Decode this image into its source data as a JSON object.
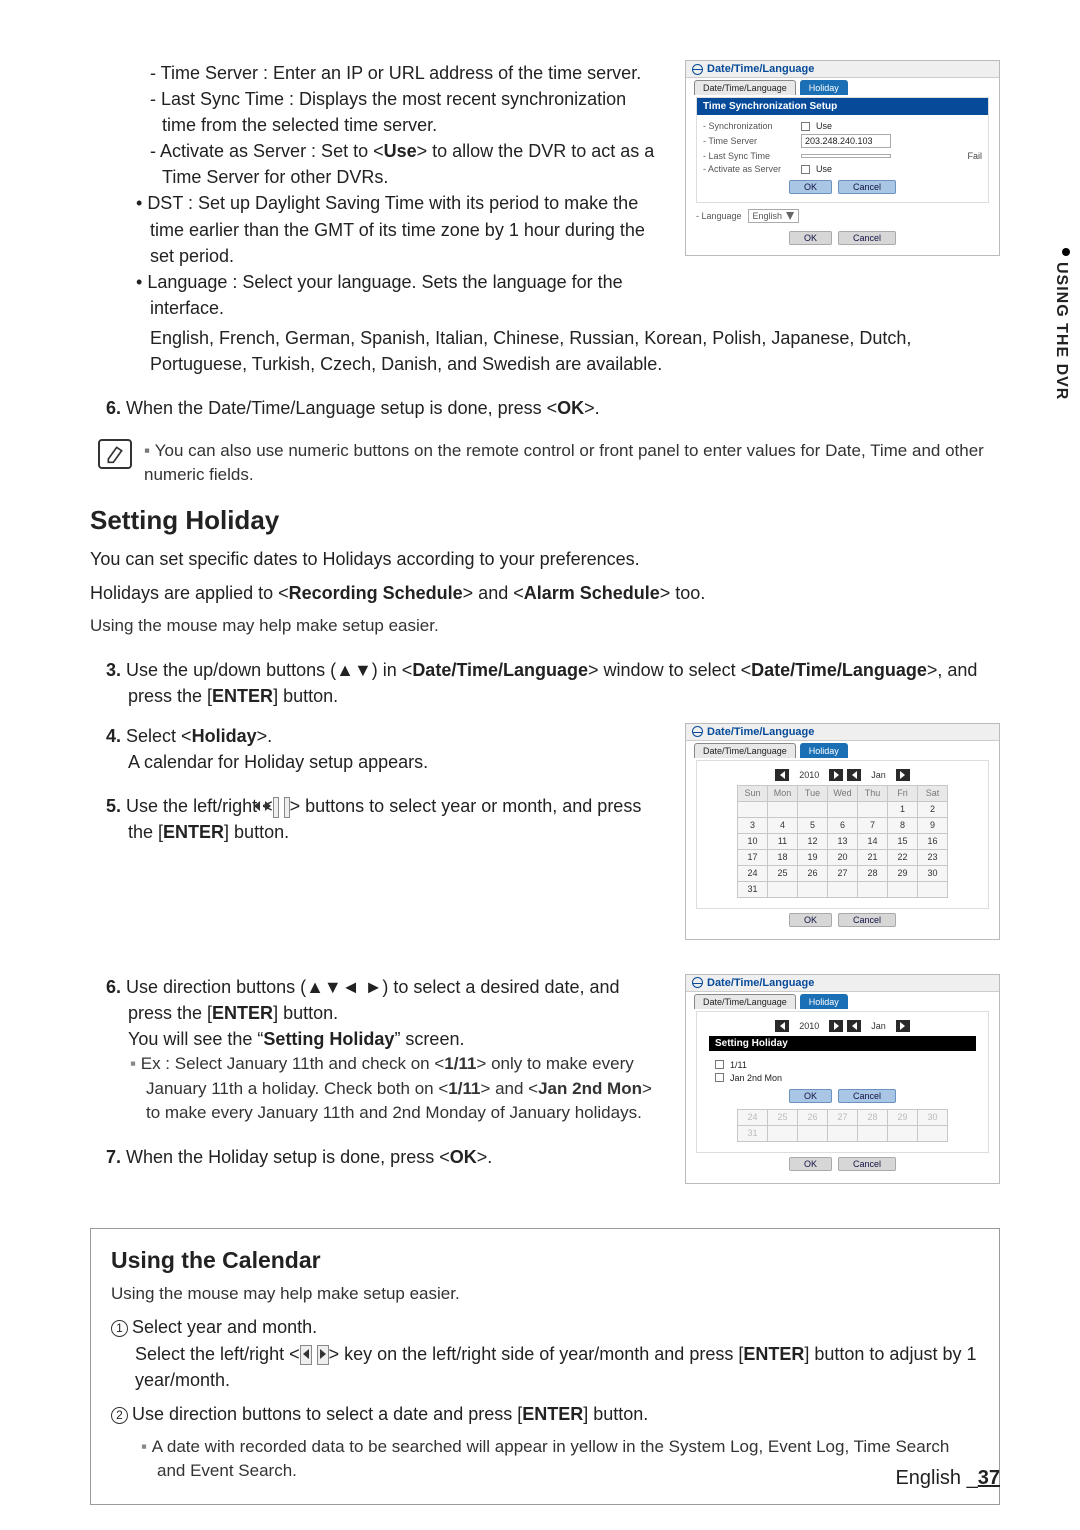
{
  "sidetab": {
    "label": "USING THE DVR"
  },
  "top": {
    "dash1": "- Time Server : Enter an IP or URL address of the time server.",
    "dash2": "- Last Sync Time : Displays the most recent synchronization time from the selected time server.",
    "dash3a": "- Activate as Server : Set to <",
    "dash3b": "Use",
    "dash3c": "> to allow the DVR to act as a Time Server for other DVRs.",
    "b1": "DST : Set up Daylight Saving Time with its period to make the time earlier than the GMT of its time zone by 1 hour during the set period.",
    "b2": "Language : Select your language. Sets the language for the interface.",
    "after": "English, French, German, Spanish, Italian, Chinese, Russian, Korean, Polish, Japanese, Dutch, Portuguese, Turkish, Czech, Danish, and Swedish are available."
  },
  "fig1": {
    "title": "Date/Time/Language",
    "tab1": "Date/Time/Language",
    "tab2": "Holiday",
    "bar": "Time Synchronization Setup",
    "r1l": "- Synchronization",
    "r1v": "Use",
    "r2l": "- Time Server",
    "r2v": "203.248.240.103",
    "r3l": "- Last Sync Time",
    "r3v": "Fail",
    "r4l": "- Activate as Server",
    "r4v": "Use",
    "ok": "OK",
    "cancel": "Cancel",
    "langlabel": "- Language",
    "langval": "English"
  },
  "step6a": "6.",
  "step6b": "When the Date/Time/Language setup is done, press <",
  "step6c": "OK",
  "step6d": ">.",
  "note1": "You can also use numeric buttons on the remote control or front panel to enter values for Date, Time and other numeric fields.",
  "section_holiday": {
    "title": "Setting Holiday",
    "p1a": "You can set specific dates to Holidays according to your preferences.",
    "p1b_a": "Holidays are applied to <",
    "p1b_b": "Recording Schedule",
    "p1b_c": "> and <",
    "p1b_d": "Alarm Schedule",
    "p1b_e": "> too.",
    "p2": "Using the mouse may help make setup easier.",
    "s3a": "3.",
    "s3b": "Use the up/down buttons (▲▼) in <",
    "s3c": "Date/Time/Language",
    "s3d": "> window to select <",
    "s3e": "Date/Time/Language",
    "s3f": ">, and press the [",
    "s3g": "ENTER",
    "s3h": "] button.",
    "s4a": "4.",
    "s4b": "Select <",
    "s4c": "Holiday",
    "s4d": ">.",
    "s4e": "A calendar for Holiday setup appears.",
    "s5a": "5.",
    "s5b": "Use the left/right <",
    "s5c": "> buttons to select year or month, and press the [",
    "s5d": "ENTER",
    "s5e": "] button."
  },
  "fig2": {
    "title": "Date/Time/Language",
    "tab1": "Date/Time/Language",
    "tab2": "Holiday",
    "year": "2010",
    "month": "Jan",
    "dow": [
      "Sun",
      "Mon",
      "Tue",
      "Wed",
      "Thu",
      "Fri",
      "Sat"
    ],
    "ok": "OK",
    "cancel": "Cancel"
  },
  "chart_data": {
    "type": "table",
    "title": "Holiday calendar — January 2010",
    "columns": [
      "Sun",
      "Mon",
      "Tue",
      "Wed",
      "Thu",
      "Fri",
      "Sat"
    ],
    "rows": [
      [
        "",
        "",
        "",
        "",
        "",
        "1",
        "2"
      ],
      [
        "3",
        "4",
        "5",
        "6",
        "7",
        "8",
        "9"
      ],
      [
        "10",
        "11",
        "12",
        "13",
        "14",
        "15",
        "16"
      ],
      [
        "17",
        "18",
        "19",
        "20",
        "21",
        "22",
        "23"
      ],
      [
        "24",
        "25",
        "26",
        "27",
        "28",
        "29",
        "30"
      ],
      [
        "31",
        "",
        "",
        "",
        "",
        "",
        ""
      ]
    ]
  },
  "row3": {
    "s6a": "6.",
    "s6b": "Use direction buttons (▲▼◄ ►) to select a desired date, and press the [",
    "s6c": "ENTER",
    "s6d": "] button.",
    "s6e_a": "You will see the “",
    "s6e_b": "Setting Holiday",
    "s6e_c": "” screen.",
    "sub_a": "Ex : Select January 11th and check on <",
    "sub_b": "1/11",
    "sub_c": "> only to make every January 11th a holiday. Check both on <",
    "sub_d": "1/11",
    "sub_e": "> and <",
    "sub_f": "Jan 2nd Mon",
    "sub_g": "> to make every January 11th and 2nd Monday of January holidays.",
    "s7a": "7.",
    "s7b": "When the Holiday setup is done, press <",
    "s7c": "OK",
    "s7d": ">."
  },
  "fig3": {
    "title": "Date/Time/Language",
    "tab1": "Date/Time/Language",
    "tab2": "Holiday",
    "year": "2010",
    "month": "Jan",
    "barlabel": "Setting Holiday",
    "opt1": "1/11",
    "opt2": "Jan 2nd Mon",
    "ok": "OK",
    "cancel": "Cancel",
    "row_vals": [
      "24",
      "25",
      "26",
      "27",
      "28",
      "29",
      "30"
    ],
    "row2_vals": [
      "31",
      "",
      "",
      "",
      "",
      "",
      ""
    ]
  },
  "callout": {
    "title": "Using the Calendar",
    "p1": "Using the mouse may help make setup easier.",
    "l1": "Select year and month.",
    "l1b_a": "Select the left/right <",
    "l1b_b": "> key on the left/right side of year/month and press [",
    "l1b_c": "ENTER",
    "l1b_d": "] button to adjust by 1 year/month.",
    "l2_a": "Use direction buttons to select a date and press [",
    "l2_b": "ENTER",
    "l2_c": "] button.",
    "sub": "A date with recorded data to be searched will appear in yellow in the System Log, Event Log, Time Search and Event Search."
  },
  "footer": {
    "lang": "English",
    "page": "37"
  }
}
